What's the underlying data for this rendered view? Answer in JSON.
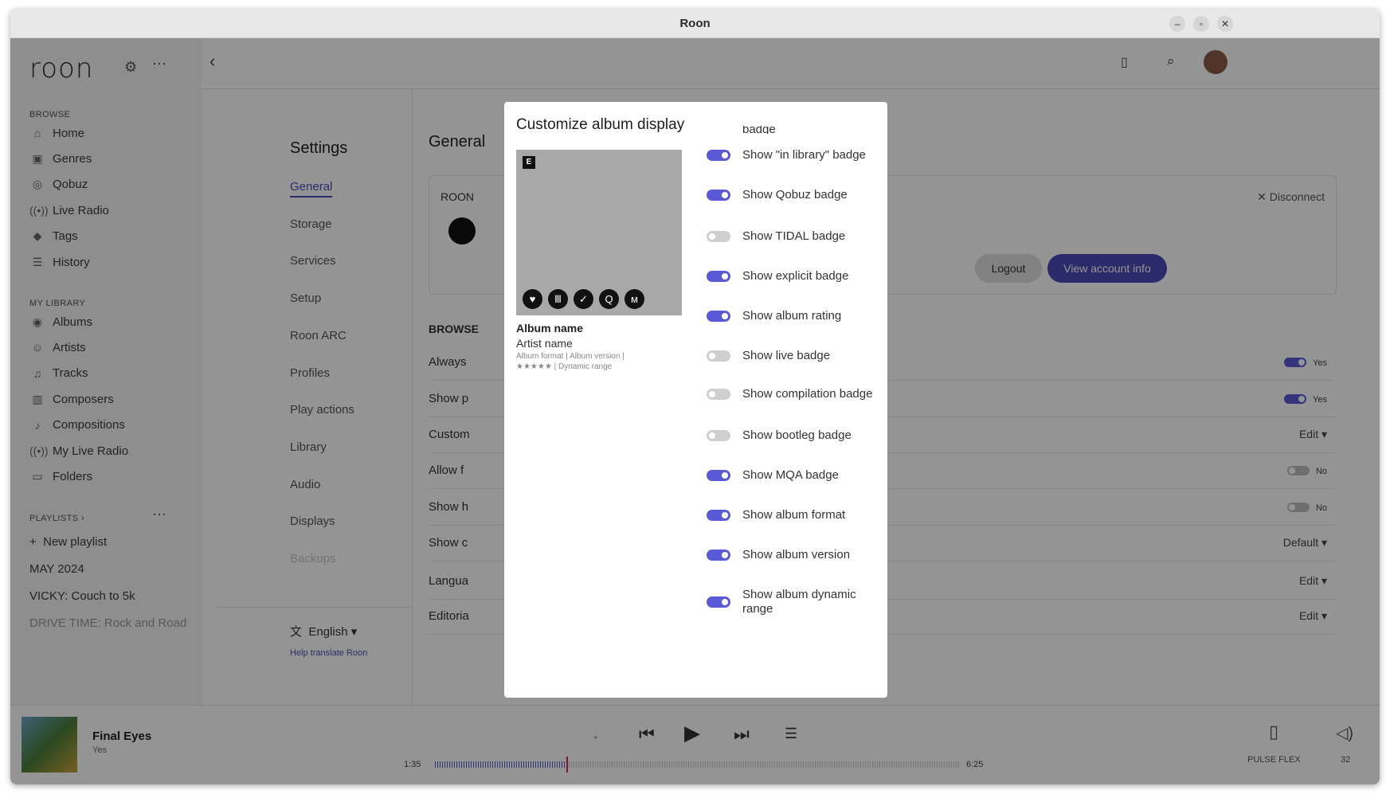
{
  "window": {
    "title": "Roon"
  },
  "sidebar": {
    "logo": "roon",
    "browse_heading": "BROWSE",
    "browse": [
      {
        "label": "Home",
        "icon": "home-icon",
        "glyph": "⌂"
      },
      {
        "label": "Genres",
        "icon": "genres-icon",
        "glyph": "▣"
      },
      {
        "label": "Qobuz",
        "icon": "qobuz-icon",
        "glyph": "◎"
      },
      {
        "label": "Live Radio",
        "icon": "radio-icon",
        "glyph": "((•))"
      },
      {
        "label": "Tags",
        "icon": "tag-icon",
        "glyph": "◆"
      },
      {
        "label": "History",
        "icon": "history-icon",
        "glyph": "☰"
      }
    ],
    "library_heading": "MY LIBRARY",
    "library": [
      {
        "label": "Albums",
        "icon": "album-icon",
        "glyph": "◉"
      },
      {
        "label": "Artists",
        "icon": "artist-icon",
        "glyph": "☺"
      },
      {
        "label": "Tracks",
        "icon": "track-icon",
        "glyph": "♫"
      },
      {
        "label": "Composers",
        "icon": "composer-icon",
        "glyph": "▥"
      },
      {
        "label": "Compositions",
        "icon": "composition-icon",
        "glyph": "♪"
      },
      {
        "label": "My Live Radio",
        "icon": "radio-icon",
        "glyph": "((•))"
      },
      {
        "label": "Folders",
        "icon": "folder-icon",
        "glyph": "▭"
      }
    ],
    "playlists_heading": "PLAYLISTS",
    "new_playlist": "New playlist",
    "playlists": [
      "MAY 2024",
      "VICKY: Couch to 5k",
      "DRIVE TIME: Rock and Road"
    ]
  },
  "settings_nav": {
    "title": "Settings",
    "items": [
      "General",
      "Storage",
      "Services",
      "Setup",
      "Roon ARC",
      "Profiles",
      "Play actions",
      "Library",
      "Audio",
      "Displays",
      "Backups"
    ],
    "language": "English",
    "help_link": "Help translate Roon"
  },
  "general": {
    "heading": "General",
    "account_label": "ROON",
    "disconnect": "Disconnect",
    "logout": "Logout",
    "view_account": "View account info",
    "browse_heading": "BROWSE",
    "rows": [
      {
        "label": "Always",
        "value": "Yes",
        "toggle": "on"
      },
      {
        "label": "Show p",
        "value": "Yes",
        "toggle": "on"
      },
      {
        "label": "Custom",
        "value": "Edit ▾",
        "toggle": ""
      },
      {
        "label": "Allow f",
        "value": "No",
        "toggle": "off"
      },
      {
        "label": "Show h",
        "value": "No",
        "toggle": "off"
      },
      {
        "label": "Show c",
        "value": "Default ▾",
        "toggle": ""
      },
      {
        "label": "Langua",
        "value": "Edit ▾",
        "toggle": ""
      },
      {
        "label": "Editoria",
        "value": "Edit ▾",
        "toggle": ""
      }
    ]
  },
  "player": {
    "track": "Final Eyes",
    "artist": "Yes",
    "elapsed": "1:35",
    "duration": "6:25",
    "progress": 0.25,
    "zone": "PULSE FLEX",
    "volume": "32"
  },
  "modal": {
    "title": "Customize album display",
    "cut_label": "badge",
    "preview": {
      "album_name": "Album name",
      "artist_name": "Artist name",
      "meta1": "Album format | Album version |",
      "meta2": "★★★★★ | Dynamic range",
      "badges": [
        {
          "name": "heart-icon",
          "glyph": "♥"
        },
        {
          "name": "library-icon",
          "glyph": "Ⅲ"
        },
        {
          "name": "check-icon",
          "glyph": "✓"
        },
        {
          "name": "qobuz-icon",
          "glyph": "Q"
        },
        {
          "name": "mqa-icon",
          "glyph": "ᴍ"
        }
      ],
      "explicit": "E"
    },
    "toggles": [
      {
        "label": "Show \"in library\" badge",
        "on": true
      },
      {
        "label": "Show Qobuz badge",
        "on": true
      },
      {
        "label": "Show TIDAL badge",
        "on": false
      },
      {
        "label": "Show explicit badge",
        "on": true
      },
      {
        "label": "Show album rating",
        "on": true
      },
      {
        "label": "Show live badge",
        "on": false
      },
      {
        "label": "Show compilation badge",
        "on": false
      },
      {
        "label": "Show bootleg badge",
        "on": false
      },
      {
        "label": "Show MQA badge",
        "on": true
      },
      {
        "label": "Show album format",
        "on": true
      },
      {
        "label": "Show album version",
        "on": true
      },
      {
        "label": "Show album dynamic range",
        "on": true
      }
    ]
  }
}
